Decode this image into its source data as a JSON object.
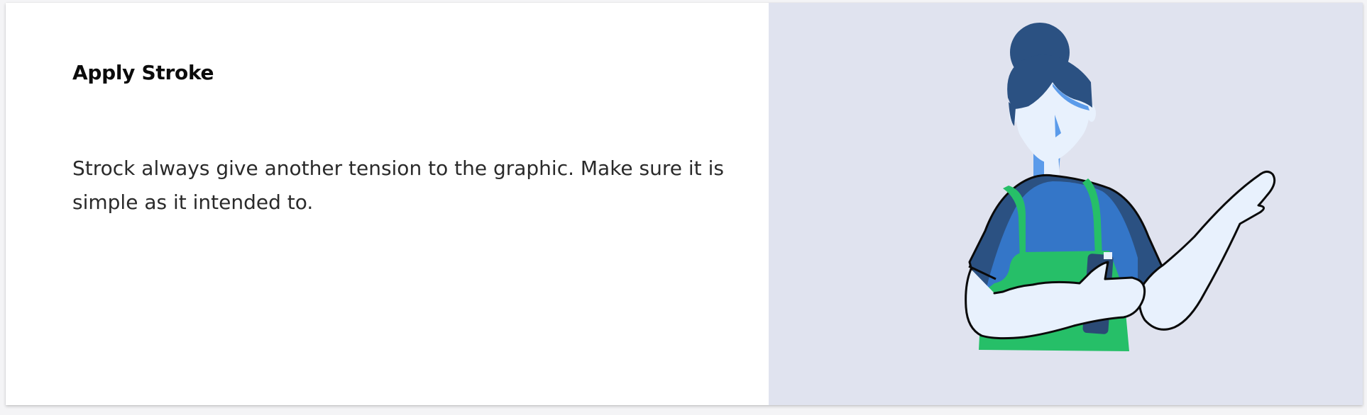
{
  "section": {
    "title": "Apply Stroke",
    "description": "Strock always give another tension to the graphic. Make sure it is simple as it intended to."
  },
  "illustration": {
    "subject": "woman-in-apron-waving-icon",
    "colors": {
      "panel_background": "#e0e3ef",
      "hair": "#2b5182",
      "hair_band": "#26b965",
      "skin": "#e8f1fd",
      "skin_shadow": "#5b9bea",
      "shirt": "#3476c8",
      "shirt_sleeve": "#2b5182",
      "apron": "#26bf68",
      "phone": "#2b4a75",
      "stroke": "#0a0a0a"
    }
  }
}
